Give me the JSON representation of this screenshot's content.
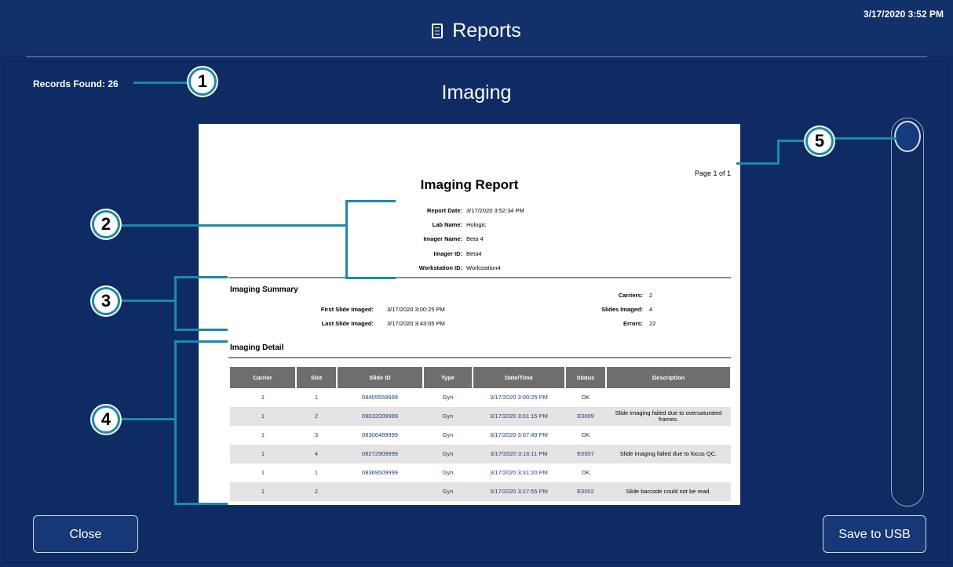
{
  "header": {
    "title": "Reports",
    "icon": "document-icon",
    "datetime": "3/17/2020 3:52 PM"
  },
  "records": {
    "label": "Records Found:",
    "count": "26"
  },
  "main_title": "Imaging",
  "report": {
    "page": "Page 1 of 1",
    "title": "Imaging Report",
    "info": [
      {
        "label": "Report Date:",
        "value": "3/17/2020 3:52:34 PM"
      },
      {
        "label": "Lab Name:",
        "value": "Hologic"
      },
      {
        "label": "Imager Name:",
        "value": "Beta 4"
      },
      {
        "label": "Imager ID:",
        "value": "Beta4"
      },
      {
        "label": "Workstation ID:",
        "value": "Workstation4"
      }
    ],
    "summary": {
      "heading": "Imaging Summary",
      "first_label": "First Slide Imaged:",
      "first_value": "3/17/2020 3:00:25 PM",
      "last_label": "Last Slide Imaged:",
      "last_value": "3/17/2020 3:43:05 PM",
      "carriers_label": "Carriers:",
      "carriers_value": "2",
      "slides_label": "Slides Imaged:",
      "slides_value": "4",
      "errors_label": "Errors:",
      "errors_value": "22"
    },
    "detail": {
      "heading": "Imaging Detail",
      "columns": [
        "Carrier",
        "Slot",
        "Slide ID",
        "Type",
        "Date/Time",
        "Status",
        "Description"
      ],
      "rows": [
        [
          "1",
          "1",
          "08405559999",
          "Gyn",
          "3/17/2020 3:00:25 PM",
          "OK",
          ""
        ],
        [
          "1",
          "2",
          "09032009999",
          "Gyn",
          "3/17/2020 3:01:15 PM",
          "E0009",
          "Slide imaging failed due to oversaturated frames."
        ],
        [
          "1",
          "3",
          "08306489999",
          "Gyn",
          "3/17/2020 3:07:49 PM",
          "OK",
          ""
        ],
        [
          "1",
          "4",
          "08272909999",
          "Gyn",
          "3/17/2020 3:16:11 PM",
          "E0007",
          "Slide imaging failed due to focus QC."
        ],
        [
          "1",
          "1",
          "08369509999",
          "Gyn",
          "3/17/2020 3:31:20 PM",
          "OK",
          ""
        ],
        [
          "1",
          "2",
          "",
          "Gyn",
          "3/17/2020 3:27:55 PM",
          "E0002",
          "Slide barcode could not be read."
        ]
      ]
    }
  },
  "buttons": {
    "close": "Close",
    "save": "Save to USB"
  },
  "callouts": [
    "1",
    "2",
    "3",
    "4",
    "5"
  ],
  "colors": {
    "background": "#0f2b63",
    "header": "#12306a",
    "callout": "#1c8aa9",
    "table_header": "#6e6e6e"
  }
}
